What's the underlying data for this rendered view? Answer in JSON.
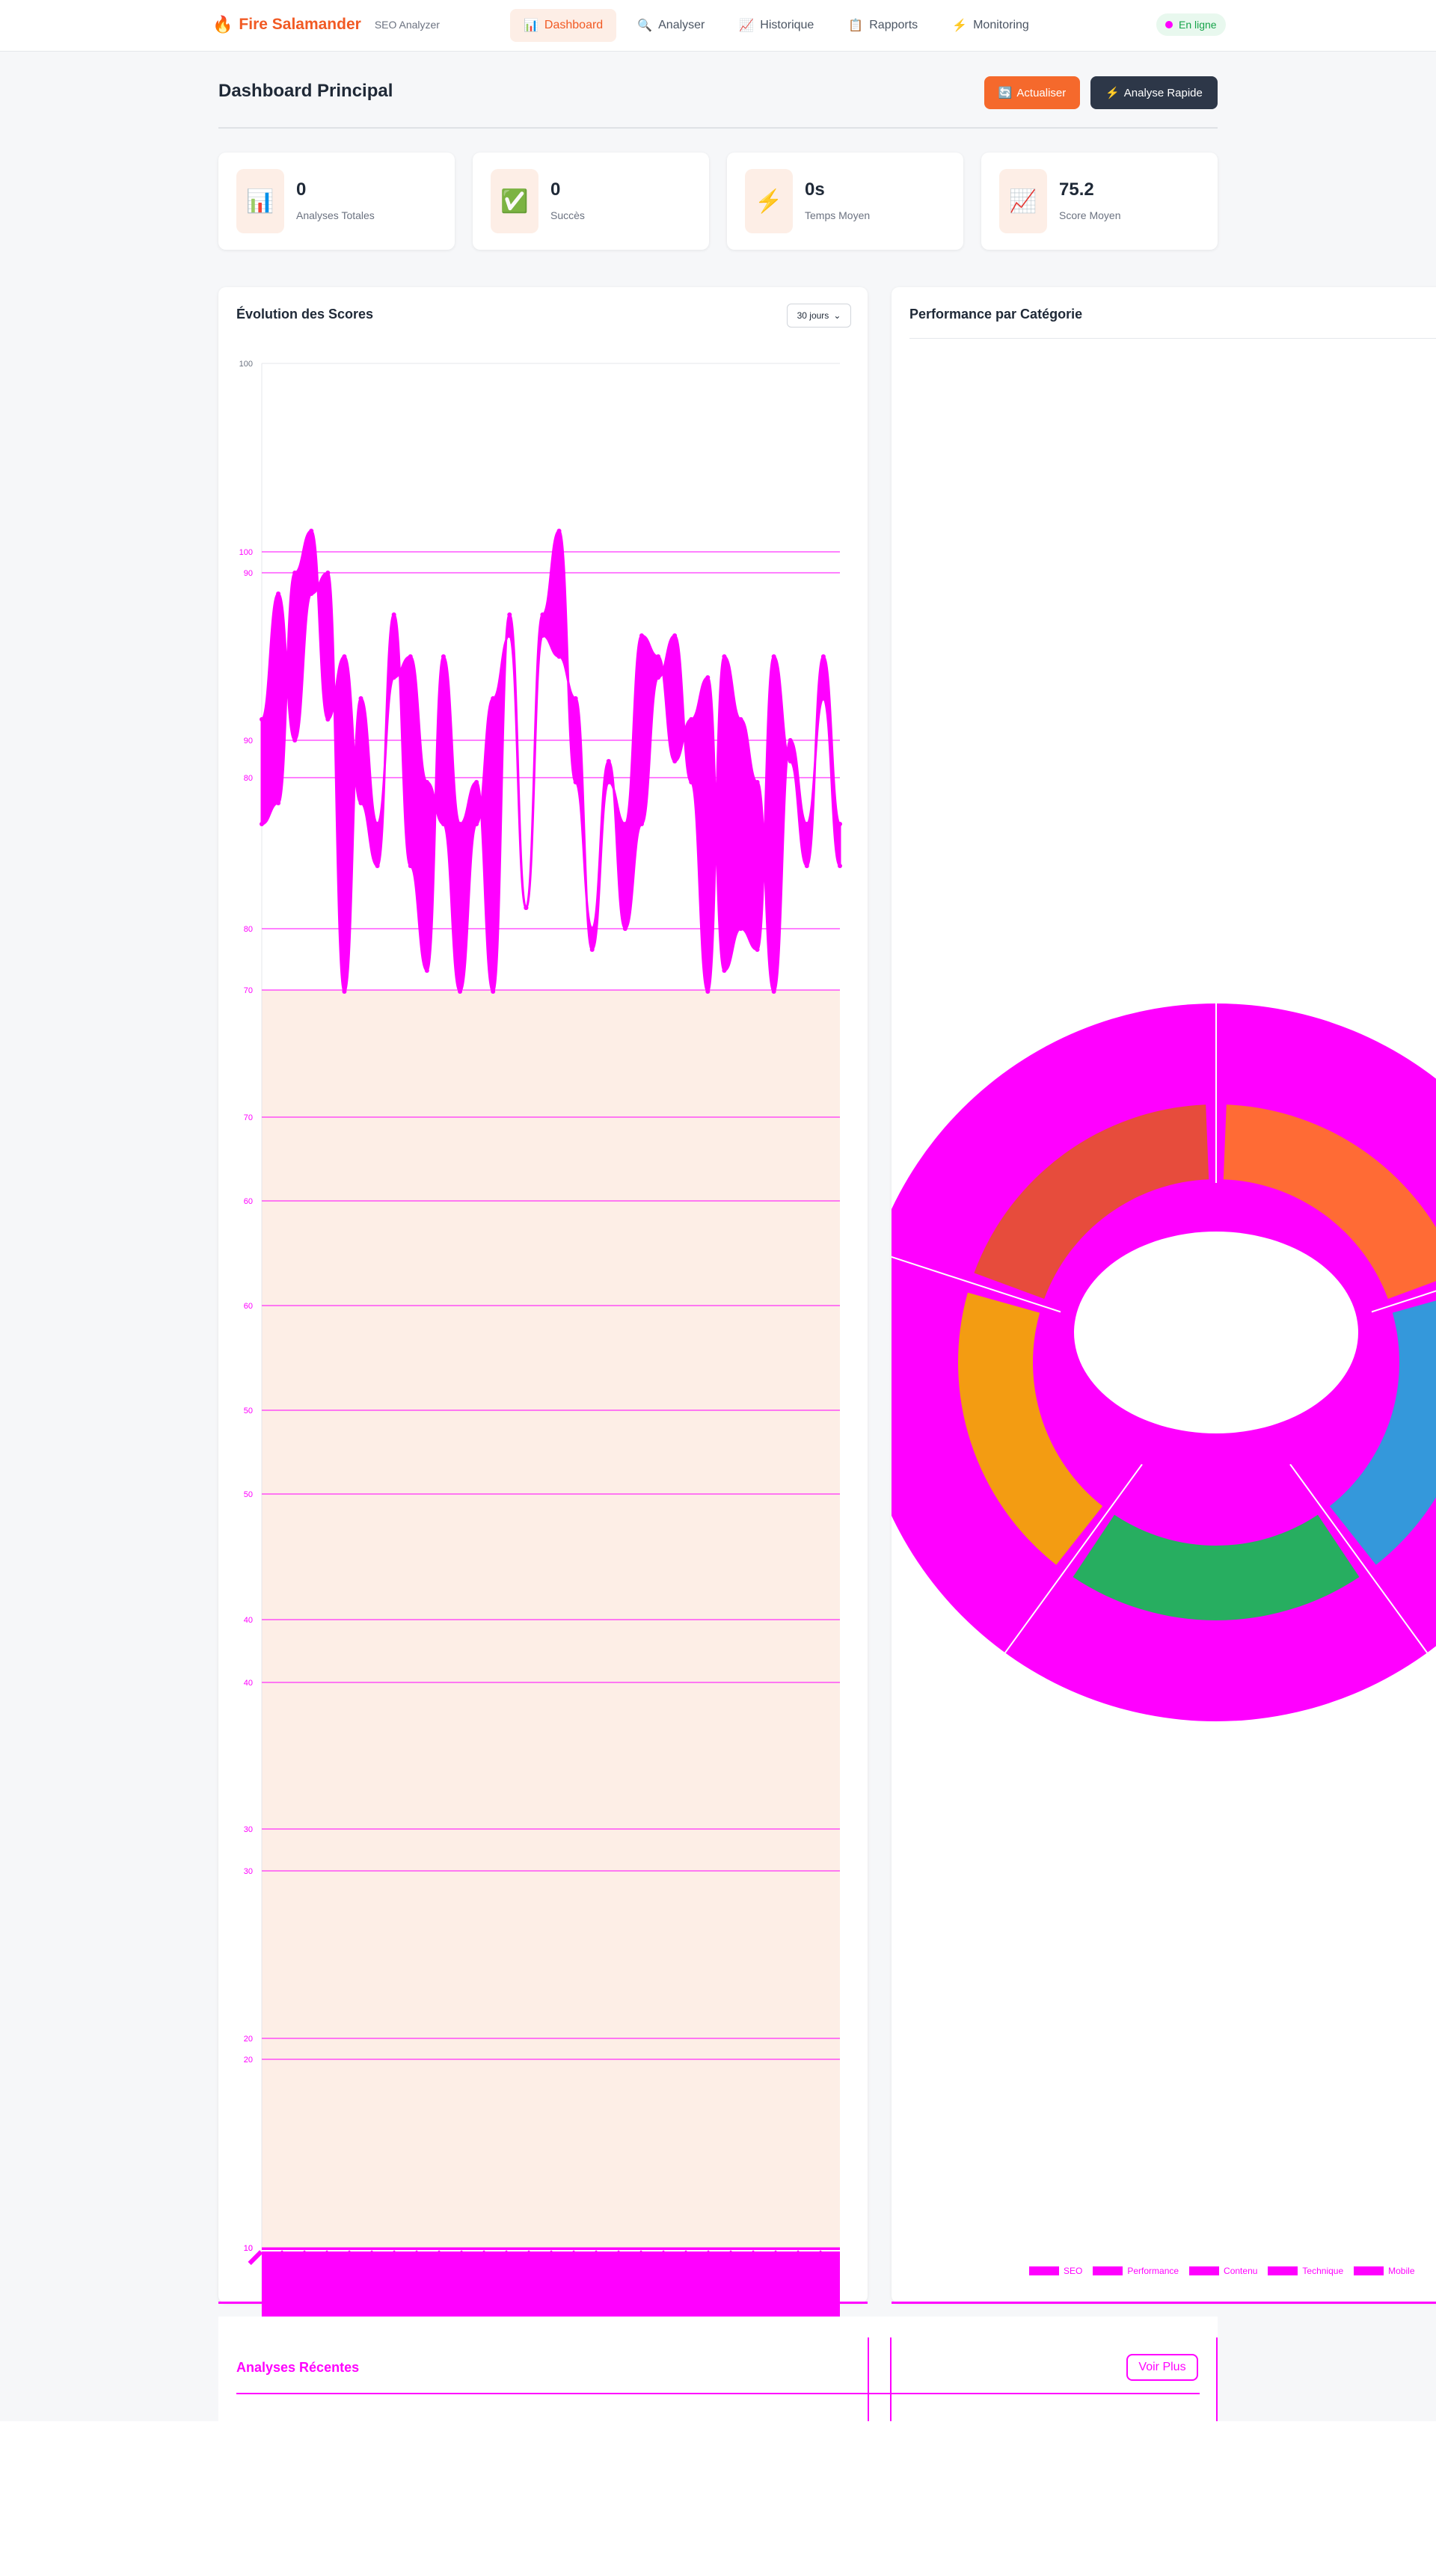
{
  "brand": {
    "icon": "fire-icon",
    "name": "Fire Salamander",
    "subtitle": "SEO Analyzer"
  },
  "nav": [
    {
      "icon": "📊",
      "label": "Dashboard",
      "active": true
    },
    {
      "icon": "🔍",
      "label": "Analyser"
    },
    {
      "icon": "📈",
      "label": "Historique"
    },
    {
      "icon": "📋",
      "label": "Rapports"
    },
    {
      "icon": "⚡",
      "label": "Monitoring"
    }
  ],
  "status": {
    "label": "En ligne"
  },
  "page": {
    "title": "Dashboard Principal"
  },
  "actions": {
    "refresh": {
      "icon": "🔄",
      "label": "Actualiser"
    },
    "quick": {
      "icon": "⚡",
      "label": "Analyse Rapide"
    }
  },
  "stats": [
    {
      "icon": "📊",
      "value": "0",
      "label": "Analyses Totales"
    },
    {
      "icon": "✅",
      "value": "0",
      "label": "Succès"
    },
    {
      "icon": "⚡",
      "value": "0s",
      "label": "Temps Moyen"
    },
    {
      "icon": "📈",
      "value": "75.2",
      "label": "Score Moyen"
    }
  ],
  "score_chart": {
    "title": "Évolution des Scores",
    "range_selected": "30 jours"
  },
  "category_chart": {
    "title": "Performance par Catégorie",
    "legend": [
      "SEO",
      "Performance",
      "Contenu",
      "Technique",
      "Mobile"
    ]
  },
  "recent": {
    "title": "Analyses Récentes",
    "more_label": "Voir Plus"
  },
  "colors": {
    "brand": "#f15a24",
    "area_fill": "#fdeee6",
    "artifact": "#ff00ff",
    "seo": "#ff6b35",
    "performance": "#3498db",
    "contenu": "#27ae60",
    "technique": "#f39c12",
    "mobile": "#e74c3c"
  },
  "chart_data": [
    {
      "type": "line",
      "title": "Évolution des Scores",
      "ylim": [
        10,
        100
      ],
      "y_ticks": [
        "100",
        "90",
        "80",
        "70",
        "60",
        "50",
        "40",
        "30",
        "20",
        "10"
      ],
      "series": [
        {
          "values": [
            83,
            89,
            82,
            89,
            90,
            70,
            84,
            78,
            85,
            86,
            80,
            78,
            70,
            78,
            84,
            87,
            74,
            88,
            92,
            80,
            73,
            81,
            73,
            78,
            85,
            87,
            80,
            70,
            86,
            83,
            80,
            70,
            82,
            78,
            84,
            76
          ]
        },
        {
          "values": [
            78,
            79,
            90,
            92,
            83,
            86,
            79,
            76,
            88,
            76,
            71,
            86,
            78,
            80,
            70,
            88,
            74,
            87,
            86,
            84,
            72,
            80,
            78,
            87,
            86,
            81,
            83,
            85,
            71,
            73,
            72,
            86,
            81,
            76,
            86,
            78
          ]
        }
      ]
    },
    {
      "type": "pie",
      "title": "Performance par Catégorie",
      "categories": [
        "SEO",
        "Performance",
        "Contenu",
        "Technique",
        "Mobile"
      ],
      "values": [
        20,
        20,
        20,
        20,
        20
      ]
    }
  ]
}
